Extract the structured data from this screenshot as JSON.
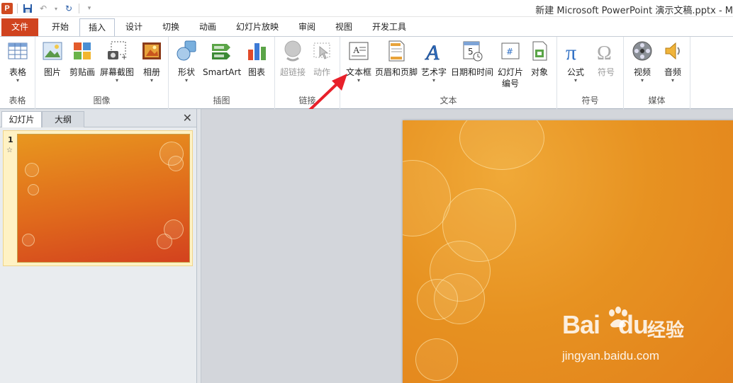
{
  "window": {
    "title": "新建 Microsoft PowerPoint 演示文稿.pptx - M",
    "app_icon": "P"
  },
  "ribbon_tabs": [
    {
      "label": "文件"
    },
    {
      "label": "开始"
    },
    {
      "label": "插入"
    },
    {
      "label": "设计"
    },
    {
      "label": "切换"
    },
    {
      "label": "动画"
    },
    {
      "label": "幻灯片放映"
    },
    {
      "label": "审阅"
    },
    {
      "label": "视图"
    },
    {
      "label": "开发工具"
    }
  ],
  "groups": {
    "table": {
      "label": "表格",
      "buttons": [
        {
          "label": "表格",
          "icon": "table-icon"
        }
      ]
    },
    "images": {
      "label": "图像",
      "buttons": [
        {
          "label": "图片",
          "icon": "picture-icon"
        },
        {
          "label": "剪贴画",
          "icon": "clipart-icon"
        },
        {
          "label": "屏幕截图",
          "icon": "screenshot-icon"
        },
        {
          "label": "相册",
          "icon": "album-icon"
        }
      ]
    },
    "illustrations": {
      "label": "插图",
      "buttons": [
        {
          "label": "形状",
          "icon": "shapes-icon"
        },
        {
          "label": "SmartArt",
          "icon": "smartart-icon"
        },
        {
          "label": "图表",
          "icon": "chart-icon"
        }
      ]
    },
    "links": {
      "label": "链接",
      "buttons": [
        {
          "label": "超链接",
          "icon": "hyperlink-icon"
        },
        {
          "label": "动作",
          "icon": "action-icon"
        }
      ]
    },
    "text": {
      "label": "文本",
      "buttons": [
        {
          "label": "文本框",
          "icon": "textbox-icon"
        },
        {
          "label": "页眉和页脚",
          "icon": "header-footer-icon"
        },
        {
          "label": "艺术字",
          "icon": "wordart-icon"
        },
        {
          "label": "日期和时间",
          "icon": "datetime-icon"
        },
        {
          "label": "幻灯片\n编号",
          "line1": "幻灯片",
          "line2": "编号",
          "icon": "slide-number-icon"
        },
        {
          "label": "对象",
          "icon": "object-icon"
        }
      ]
    },
    "symbols": {
      "label": "符号",
      "buttons": [
        {
          "label": "公式",
          "icon": "equation-icon"
        },
        {
          "label": "符号",
          "icon": "symbol-icon"
        }
      ]
    },
    "media": {
      "label": "媒体",
      "buttons": [
        {
          "label": "视频",
          "icon": "video-icon"
        },
        {
          "label": "音频",
          "icon": "audio-icon"
        }
      ]
    }
  },
  "slide_panel": {
    "tabs": [
      {
        "label": "幻灯片"
      },
      {
        "label": "大纲"
      }
    ],
    "close": "✕",
    "slides": [
      {
        "number": "1"
      }
    ]
  },
  "watermark": {
    "logo": "Bai",
    "logo_end": "du",
    "cn": "经验",
    "url": "jingyan.baidu.com"
  },
  "colors": {
    "file_tab": "#d0431f",
    "slide_orange": "#e79221",
    "annotation_arrow": "#e8202a"
  }
}
